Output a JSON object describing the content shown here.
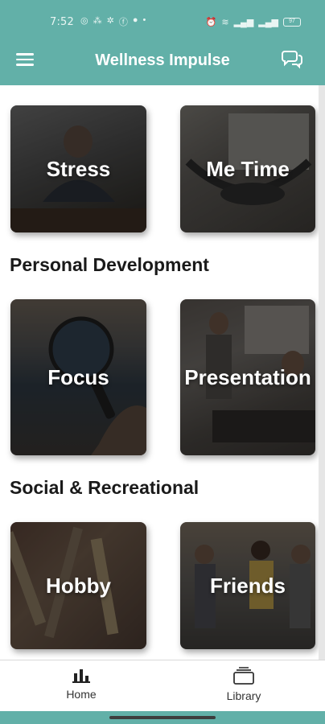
{
  "status_bar": {
    "time": "7:52",
    "battery": "97"
  },
  "app_bar": {
    "title": "Wellness Impulse",
    "menu_icon": "hamburger-menu-icon",
    "chat_icon": "chat-bubbles-icon"
  },
  "sections": [
    {
      "title": "",
      "tiles": [
        {
          "label": "Stress"
        },
        {
          "label": "Me Time"
        }
      ]
    },
    {
      "title": "Personal Development",
      "tiles": [
        {
          "label": "Focus"
        },
        {
          "label": "Presentation"
        }
      ]
    },
    {
      "title": "Social & Recreational",
      "tiles": [
        {
          "label": "Hobby"
        },
        {
          "label": "Friends"
        }
      ]
    }
  ],
  "bottom_nav": {
    "items": [
      {
        "label": "Home",
        "icon": "bar-chart-icon",
        "active": true
      },
      {
        "label": "Library",
        "icon": "library-icon",
        "active": false
      }
    ]
  },
  "colors": {
    "accent": "#62b0a8",
    "tile_overlay": "#00000066"
  }
}
